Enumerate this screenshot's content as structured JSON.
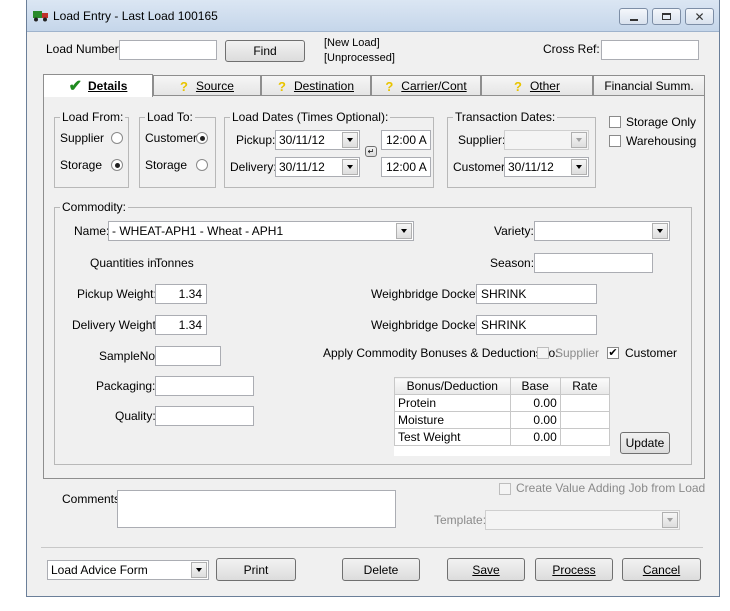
{
  "window": {
    "title": "Load Entry - Last Load 100165"
  },
  "header": {
    "load_number_label": "Load Number:",
    "load_number_value": "",
    "find_label": "Find",
    "status_line1": "[New Load]",
    "status_line2": "[Unprocessed]",
    "cross_ref_label": "Cross Ref:",
    "cross_ref_value": ""
  },
  "tabs": [
    {
      "label": "Details",
      "icon": "checkmark-icon",
      "active": true
    },
    {
      "label": "Source",
      "icon": "question-icon"
    },
    {
      "label": "Destination",
      "icon": "question-icon"
    },
    {
      "label": "Carrier/Cont",
      "icon": "question-icon"
    },
    {
      "label": "Other",
      "icon": "question-icon"
    },
    {
      "label": "Financial Summ."
    }
  ],
  "load_from": {
    "legend": "Load From:",
    "supplier": "Supplier",
    "storage": "Storage",
    "selected": "Storage"
  },
  "load_to": {
    "legend": "Load To:",
    "customer": "Customer",
    "storage": "Storage",
    "selected": "Customer"
  },
  "load_dates": {
    "legend": "Load Dates (Times Optional):",
    "pickup_label": "Pickup:",
    "pickup_date": "30/11/12",
    "pickup_time": "12:00 A",
    "delivery_label": "Delivery:",
    "delivery_date": "30/11/12",
    "delivery_time": "12:00 A"
  },
  "transaction_dates": {
    "legend": "Transaction Dates:",
    "supplier_label": "Supplier:",
    "supplier_date": "",
    "customer_label": "Customer:",
    "customer_date": "30/11/12"
  },
  "options": {
    "storage_only": "Storage Only",
    "warehousing": "Warehousing"
  },
  "commodity": {
    "legend": "Commodity:",
    "name_label": "Name:",
    "name_value": "- WHEAT-APH1 - Wheat - APH1",
    "variety_label": "Variety:",
    "variety_value": "",
    "quantities_label": "Quantities in:",
    "quantities_unit": "Tonnes",
    "season_label": "Season:",
    "season_value": "",
    "pickup_weight_label": "Pickup Weight:",
    "pickup_weight": "1.34",
    "delivery_weight_label": "Delivery Weight:",
    "delivery_weight": "1.34",
    "wb_docket1_label": "Weighbridge Docket:",
    "wb_docket1": "SHRINK",
    "wb_docket2_label": "Weighbridge Docket:",
    "wb_docket2": "SHRINK",
    "sampleno_label": "SampleNo:",
    "sampleno": "",
    "apply_label": "Apply Commodity Bonuses & Deductions to:",
    "apply_supplier": "Supplier",
    "apply_customer": "Customer",
    "packaging_label": "Packaging:",
    "packaging": "",
    "quality_label": "Quality:",
    "quality": "",
    "update_label": "Update"
  },
  "bonus_table": {
    "headers": [
      "Bonus/Deduction",
      "Base",
      "Rate"
    ],
    "rows": [
      {
        "name": "Protein",
        "base": "0.00",
        "rate": ""
      },
      {
        "name": "Moisture",
        "base": "0.00",
        "rate": ""
      },
      {
        "name": "Test Weight",
        "base": "0.00",
        "rate": ""
      }
    ]
  },
  "comments": {
    "label": "Comments:",
    "value": "",
    "create_job_label": "Create Value Adding Job from Load",
    "template_label": "Template:",
    "template_value": ""
  },
  "footer": {
    "form_select": "Load Advice Form",
    "print": "Print",
    "delete": "Delete",
    "save": "Save",
    "process": "Process",
    "cancel": "Cancel"
  },
  "colors": {
    "window_bg": "#f0f0f0",
    "titlebar": "#c5d6ea",
    "check_green": "#1e8a1e",
    "question_yellow": "#e9c400"
  }
}
